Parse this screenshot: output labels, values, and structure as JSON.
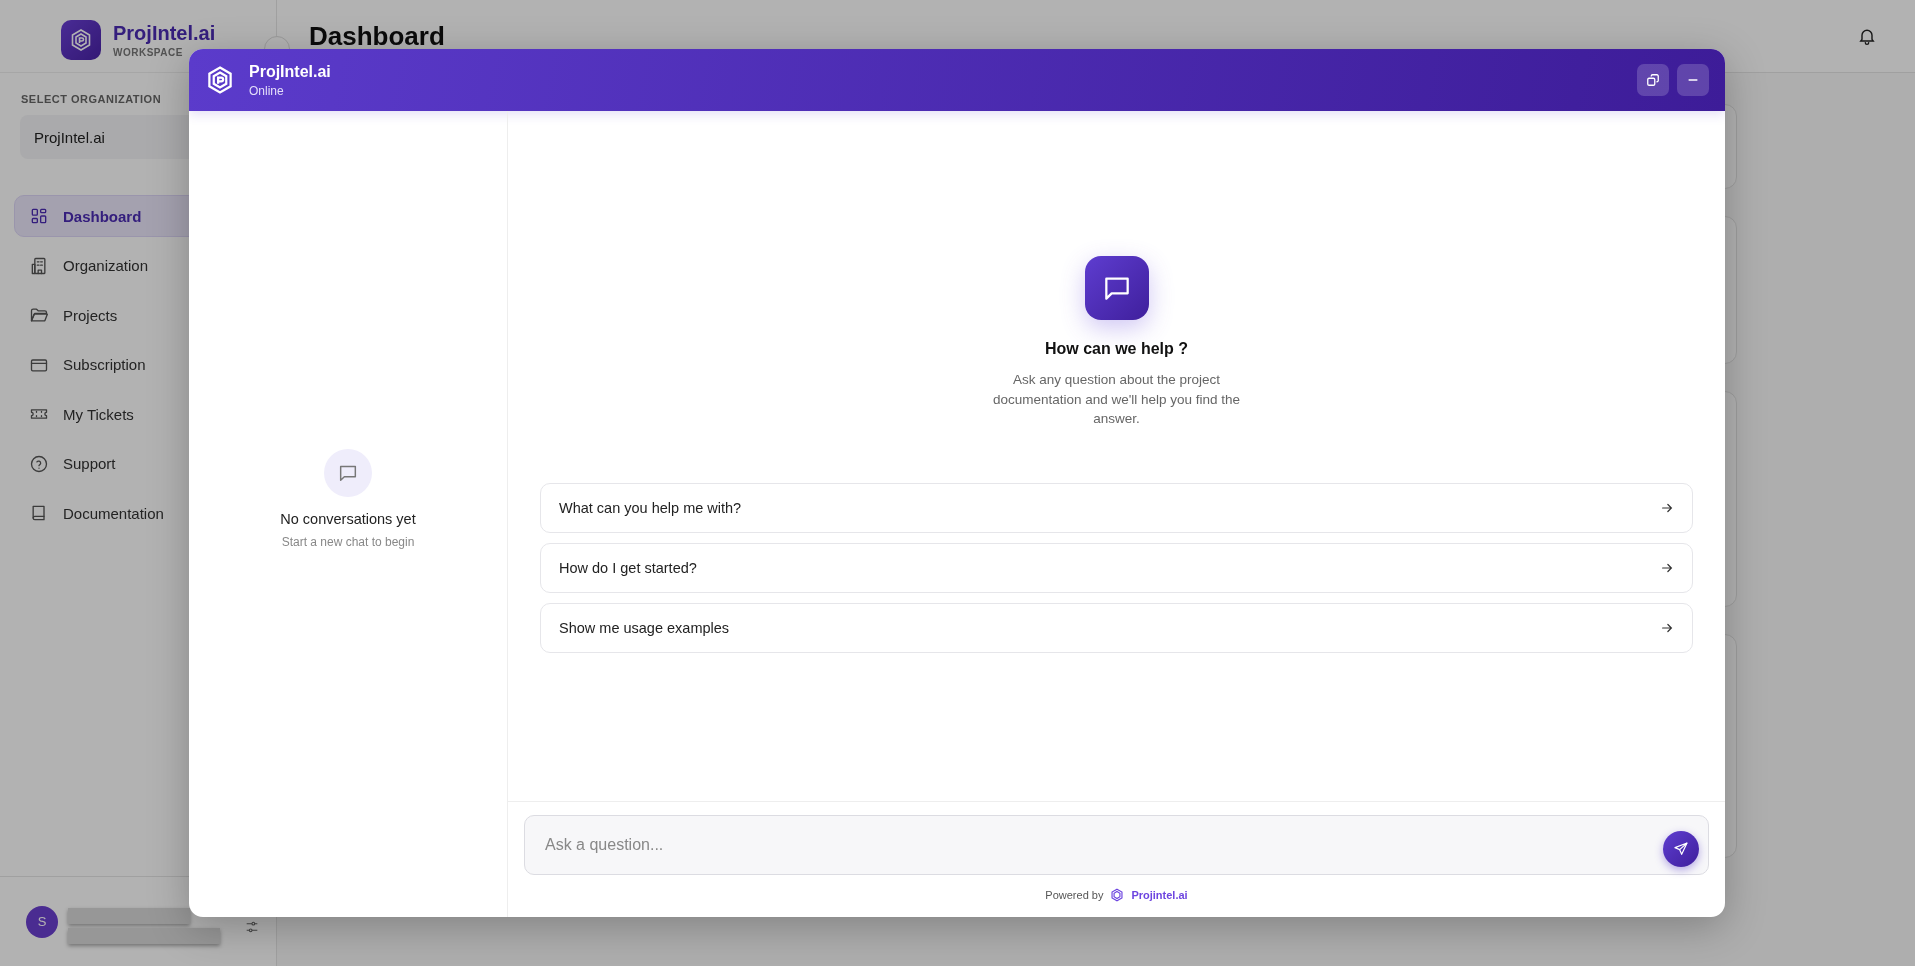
{
  "sidebar": {
    "brand": {
      "name": "ProjIntel.ai",
      "subtitle": "WORKSPACE"
    },
    "org_label": "SELECT ORGANIZATION",
    "org_value": "ProjIntel.ai",
    "items": [
      {
        "label": "Dashboard",
        "selected": true
      },
      {
        "label": "Organization",
        "selected": false
      },
      {
        "label": "Projects",
        "selected": false
      },
      {
        "label": "Subscription",
        "selected": false
      },
      {
        "label": "My Tickets",
        "selected": false
      },
      {
        "label": "Support",
        "selected": false
      },
      {
        "label": "Documentation",
        "selected": false
      }
    ],
    "user": {
      "initial": "S"
    }
  },
  "page": {
    "title": "Dashboard"
  },
  "chat": {
    "title": "ProjIntel.ai",
    "status": "Online",
    "empty": {
      "title": "No conversations yet",
      "subtitle": "Start a new chat to begin"
    },
    "welcome": {
      "title": "How can we help ?",
      "text": "Ask any question about the project documentation and we'll help you find the answer."
    },
    "suggestions": [
      "What can you help me with?",
      "How do I get started?",
      "Show me usage examples"
    ],
    "input": {
      "placeholder": "Ask a question..."
    },
    "footer": {
      "prefix": "Powered by",
      "brand": "Projintel.ai"
    }
  }
}
